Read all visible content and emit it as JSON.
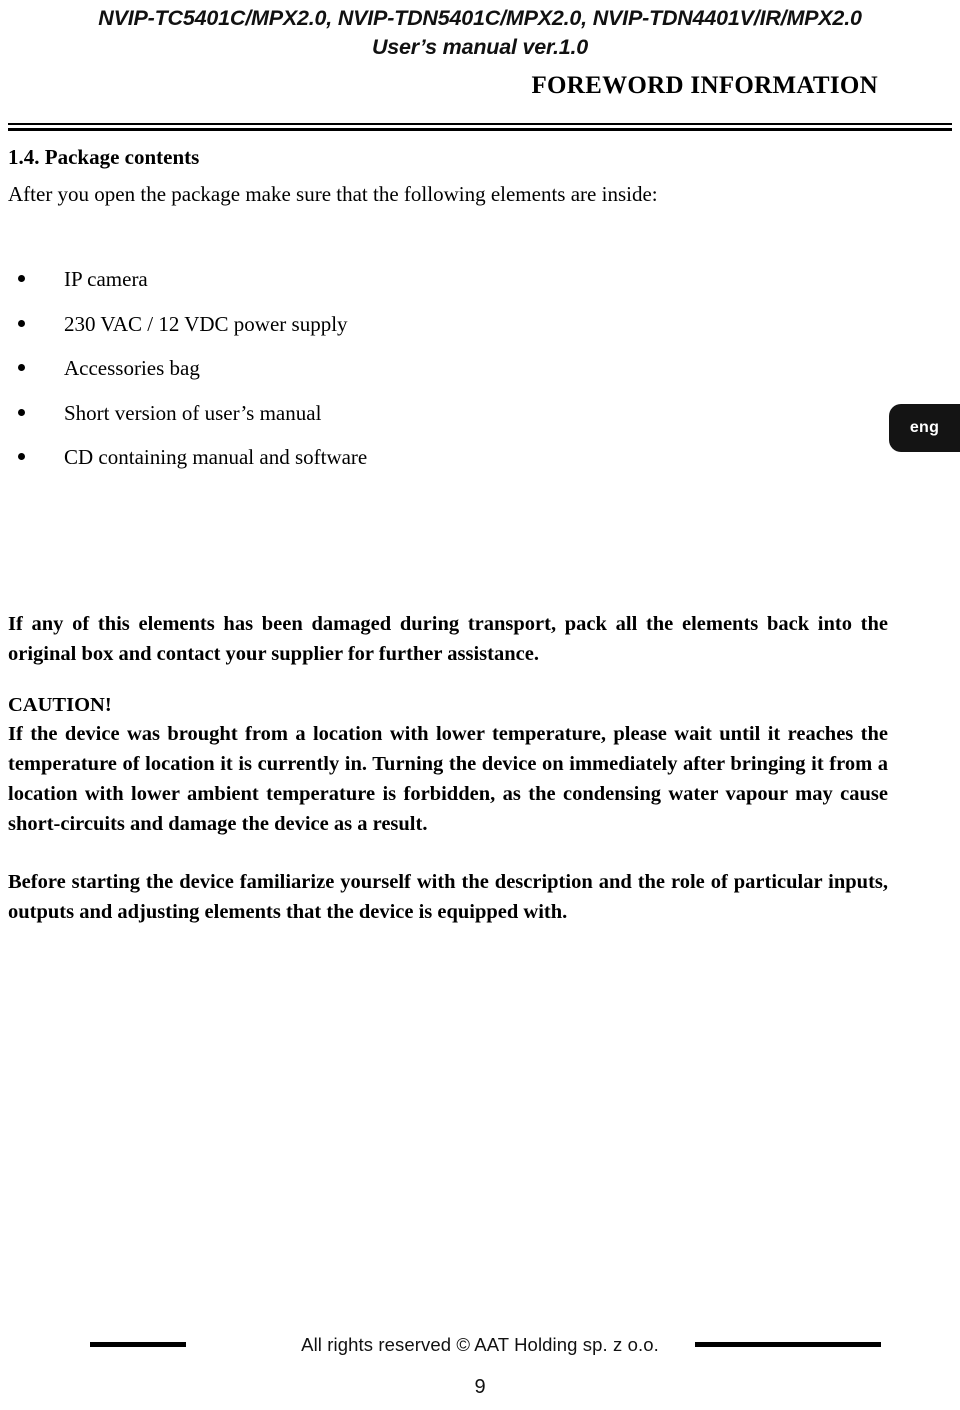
{
  "header": {
    "models_line": "NVIP-TC5401C/MPX2.0, NVIP-TDN5401C/MPX2.0, NVIP-TDN4401V/IR/MPX2.0",
    "manual_line": "User’s manual ver.1.0",
    "chapter_title": "FOREWORD INFORMATION"
  },
  "section": {
    "heading": "1.4. Package contents",
    "intro": "After you open the package make sure that the following elements are inside:",
    "items": [
      {
        "label": "IP camera"
      },
      {
        "label": "230 VAC / 12 VDC power supply"
      },
      {
        "label": "Accessories bag"
      },
      {
        "label": "Short version of user’s manual"
      },
      {
        "label": "CD containing manual and software"
      }
    ]
  },
  "language_tab": {
    "label": "eng",
    "color": "#141414"
  },
  "notes": {
    "damaged_paragraph": "If any of this elements has been damaged during transport, pack all the elements back into the original box and contact your supplier for further assistance.",
    "caution_label": "CAUTION!",
    "caution_paragraph": "If the device was brought from a location with lower temperature, please wait until it reaches the temperature of location it is currently in. Turning the device on immediately after bringing it from a location with lower ambient temperature is forbidden, as the condensing water vapour may cause short-circuits and damage the device as a result.",
    "before_paragraph": "Before starting the device familiarize yourself with the description and the role of particular inputs, outputs and adjusting elements that the device is equipped with."
  },
  "footer": {
    "copyright": "All rights reserved © AAT Holding sp. z o.o.",
    "page_number": "9"
  }
}
